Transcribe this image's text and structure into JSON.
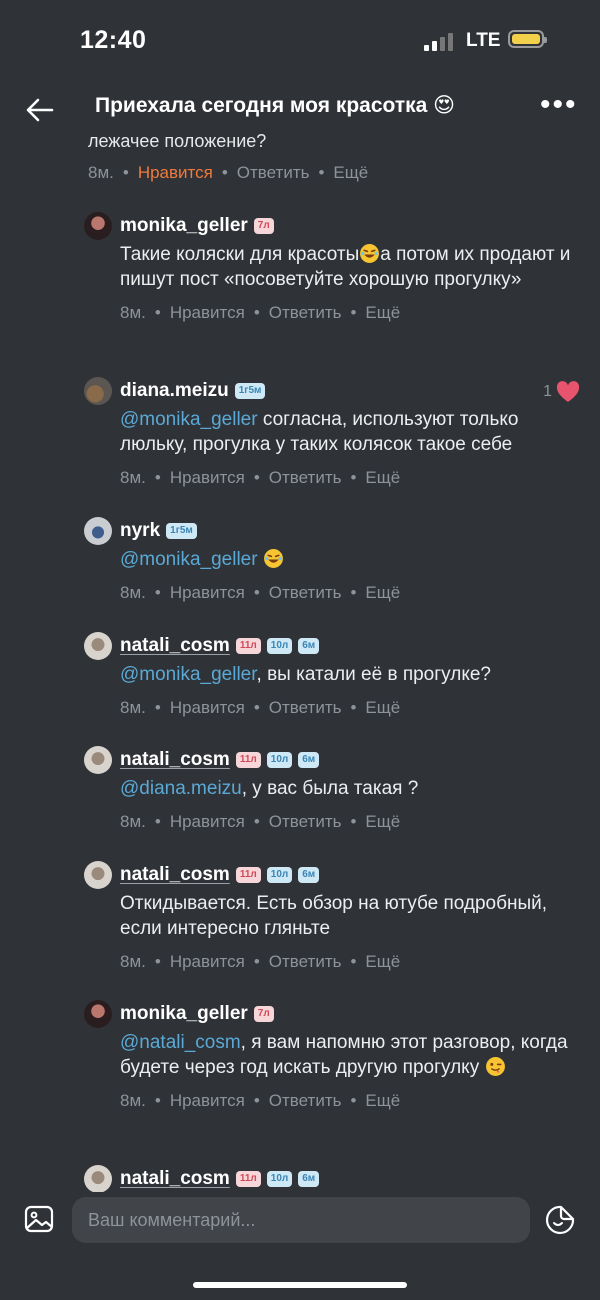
{
  "status": {
    "time": "12:40",
    "network": "LTE"
  },
  "nav": {
    "title": "Приехала сегодня моя красотка 😍"
  },
  "partial_comment": {
    "text": "лежачее положение?",
    "time": "8м.",
    "like": "Нравится",
    "reply": "Ответить",
    "more": "Ещё"
  },
  "comments": [
    {
      "username": "monika_geller",
      "badges": [
        "7л"
      ],
      "text_parts": [
        "Такие коляски для красоты",
        "а потом их продают и пишут пост «посоветуйте хорошую прогулку»"
      ],
      "time": "8м.",
      "like": "Нравится",
      "reply": "Ответить",
      "more": "Ещё"
    },
    {
      "username": "diana.meizu",
      "badges": [
        "1г5м"
      ],
      "mention": "@monika_geller",
      "text": " согласна, используют только люльку, прогулка у таких колясок такое себе",
      "likes_count": "1",
      "time": "8м.",
      "like": "Нравится",
      "reply": "Ответить",
      "more": "Ещё"
    },
    {
      "username": "nyrk",
      "badges": [
        "1г5м"
      ],
      "mention": "@monika_geller",
      "text": "",
      "time": "8м.",
      "like": "Нравится",
      "reply": "Ответить",
      "more": "Ещё"
    },
    {
      "username": "natali_cosm",
      "badges": [
        "11л",
        "10л",
        "6м"
      ],
      "mention": "@monika_geller",
      "text": ", вы катали её в прогулке?",
      "time": "8м.",
      "like": "Нравится",
      "reply": "Ответить",
      "more": "Ещё"
    },
    {
      "username": "natali_cosm",
      "badges": [
        "11л",
        "10л",
        "6м"
      ],
      "mention": "@diana.meizu",
      "text": ", у вас была такая ?",
      "time": "8м.",
      "like": "Нравится",
      "reply": "Ответить",
      "more": "Ещё"
    },
    {
      "username": "natali_cosm",
      "badges": [
        "11л",
        "10л",
        "6м"
      ],
      "text": "Откидывается. Есть обзор на ютубе подробный, если интересно гляньте",
      "time": "8м.",
      "like": "Нравится",
      "reply": "Ответить",
      "more": "Ещё"
    },
    {
      "username": "monika_geller",
      "badges": [
        "7л"
      ],
      "mention": "@natali_cosm",
      "text": ", я вам напомню этот разговор, когда будете через год искать другую прогулку ",
      "time": "8м.",
      "like": "Нравится",
      "reply": "Ответить",
      "more": "Ещё"
    },
    {
      "username": "natali_cosm",
      "badges": [
        "11л",
        "10л",
        "6м"
      ]
    }
  ],
  "input": {
    "placeholder": "Ваш комментарий..."
  },
  "colors": {
    "background": "#2f3237",
    "mention": "#5aa9d6",
    "liked": "#f07a3c",
    "heart": "#e8536d",
    "meta": "#8d939a"
  }
}
